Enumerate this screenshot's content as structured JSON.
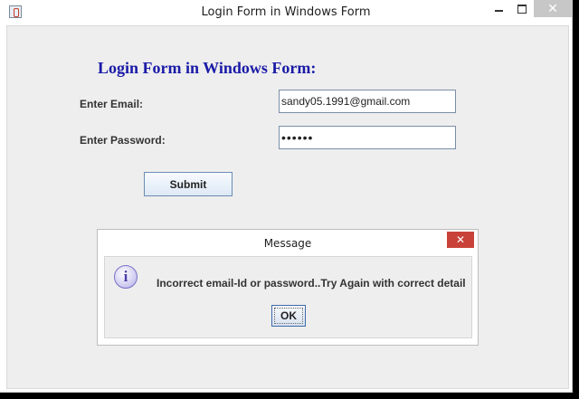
{
  "window": {
    "title": "Login Form in Windows Form",
    "close_glyph": "✕"
  },
  "form": {
    "heading": "Login Form in Windows Form:",
    "email_label": "Enter Email:",
    "email_value": "sandy05.1991@gmail.com",
    "password_label": "Enter Password:",
    "password_value": "••••••",
    "submit_label": "Submit"
  },
  "dialog": {
    "title": "Message",
    "close_glyph": "✕",
    "icon": "info-icon",
    "icon_glyph": "i",
    "message": "Incorrect email-Id or password..Try Again with correct detail",
    "ok_label": "OK"
  },
  "colors": {
    "heading": "#1a1aa8",
    "dialog_close": "#c8423a",
    "window_close": "#c7c7c7"
  }
}
